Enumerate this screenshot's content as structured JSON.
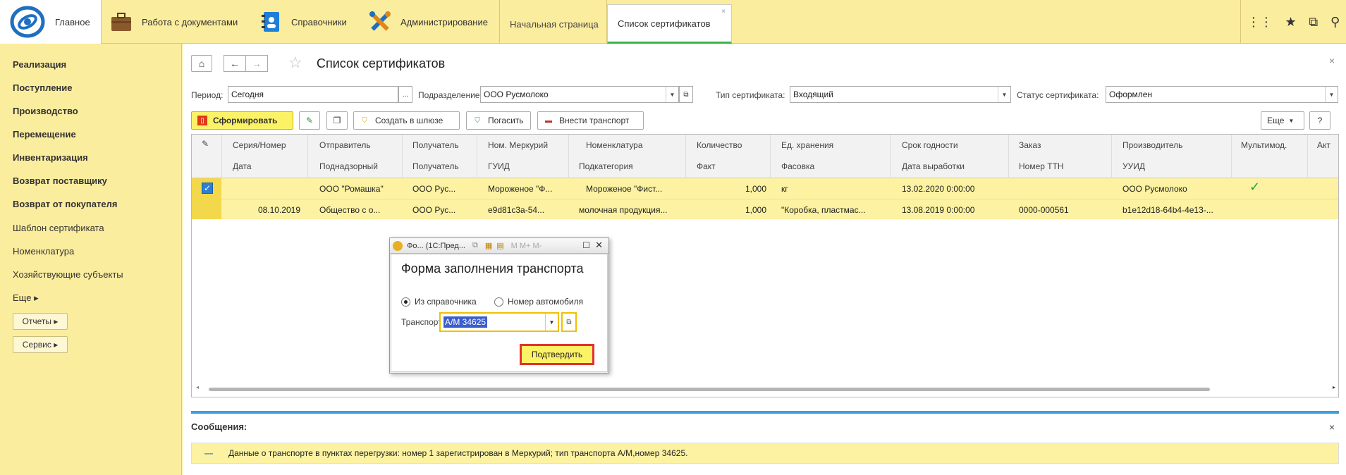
{
  "header": {
    "main_label": "Главное",
    "sections": [
      "Работа с документами",
      "Справочники",
      "Администрирование"
    ],
    "tabs": [
      "Начальная страница",
      "Список сертификатов"
    ],
    "tab_close": "×"
  },
  "sidebar": {
    "items": [
      "Реализация",
      "Поступление",
      "Производство",
      "Перемещение",
      "Инвентаризация",
      "Возврат поставщику",
      "Возврат от покупателя"
    ],
    "links": [
      "Шаблон сертификата",
      "Номенклатура",
      "Хозяйствующие субъекты",
      "Еще ▸"
    ],
    "buttons": [
      "Отчеты ▸",
      "Сервис ▸"
    ]
  },
  "page": {
    "title": "Список сертификатов",
    "close": "×"
  },
  "filters": {
    "period_label": "Период:",
    "period_value": "Сегодня",
    "period_btn": "...",
    "division_label": "Подразделение:",
    "division_value": "ООО Русмолоко",
    "type_label": "Тип сертификата:",
    "type_value": "Входящий",
    "status_label": "Статус сертификата:",
    "status_value": "Оформлен"
  },
  "toolbar": {
    "generate": "Сформировать",
    "create_gateway": "Создать в шлюзе",
    "repay": "Погасить",
    "add_transport": "Внести транспорт",
    "more": "Еще",
    "help": "?"
  },
  "table": {
    "headers_row1": [
      "Серия/Номер",
      "Отправитель",
      "Получатель",
      "Ном. Меркурий",
      "Номенклатура",
      "Количество",
      "Ед. хранения",
      "Срок годности",
      "Заказ",
      "Производитель",
      "Мультимод.",
      "Акт"
    ],
    "headers_row2": [
      "Дата",
      "Поднадзорный",
      "Получатель",
      "ГУИД",
      "Подкатегория",
      "Факт",
      "Фасовка",
      "Дата выработки",
      "Номер ТТН",
      "УУИД"
    ],
    "row1": [
      "",
      "ООО \"Ромашка\"",
      "ООО Рус...",
      "Мороженое \"Ф...",
      "Мороженое \"Фист...",
      "1,000",
      "кг",
      "13.02.2020 0:00:00",
      "",
      "ООО Русмолоко"
    ],
    "row2": [
      "08.10.2019",
      "Общество с о...",
      "ООО Рус...",
      "e9d81c3a-54...",
      "молочная продукция...",
      "1,000",
      "\"Коробка, пластмас...",
      "13.08.2019 0:00:00",
      "0000-000561",
      "b1e12d18-64b4-4e13-..."
    ]
  },
  "messages": {
    "title": "Сообщения:",
    "close": "×",
    "text": "Данные о транспорте в пунктах перегрузки: номер 1 зарегистрирован в Меркурий; тип транспорта А/М,номер 34625."
  },
  "modal": {
    "window_title": "Фо... (1С:Пред...",
    "mem_buttons": "M  M+  M-",
    "title": "Форма заполнения транспорта",
    "radio1": "Из справочника",
    "radio2": "Номер автомобиля",
    "transport_label": "Транспорт:",
    "transport_value": "А/М 34625",
    "confirm": "Подтвердить"
  }
}
